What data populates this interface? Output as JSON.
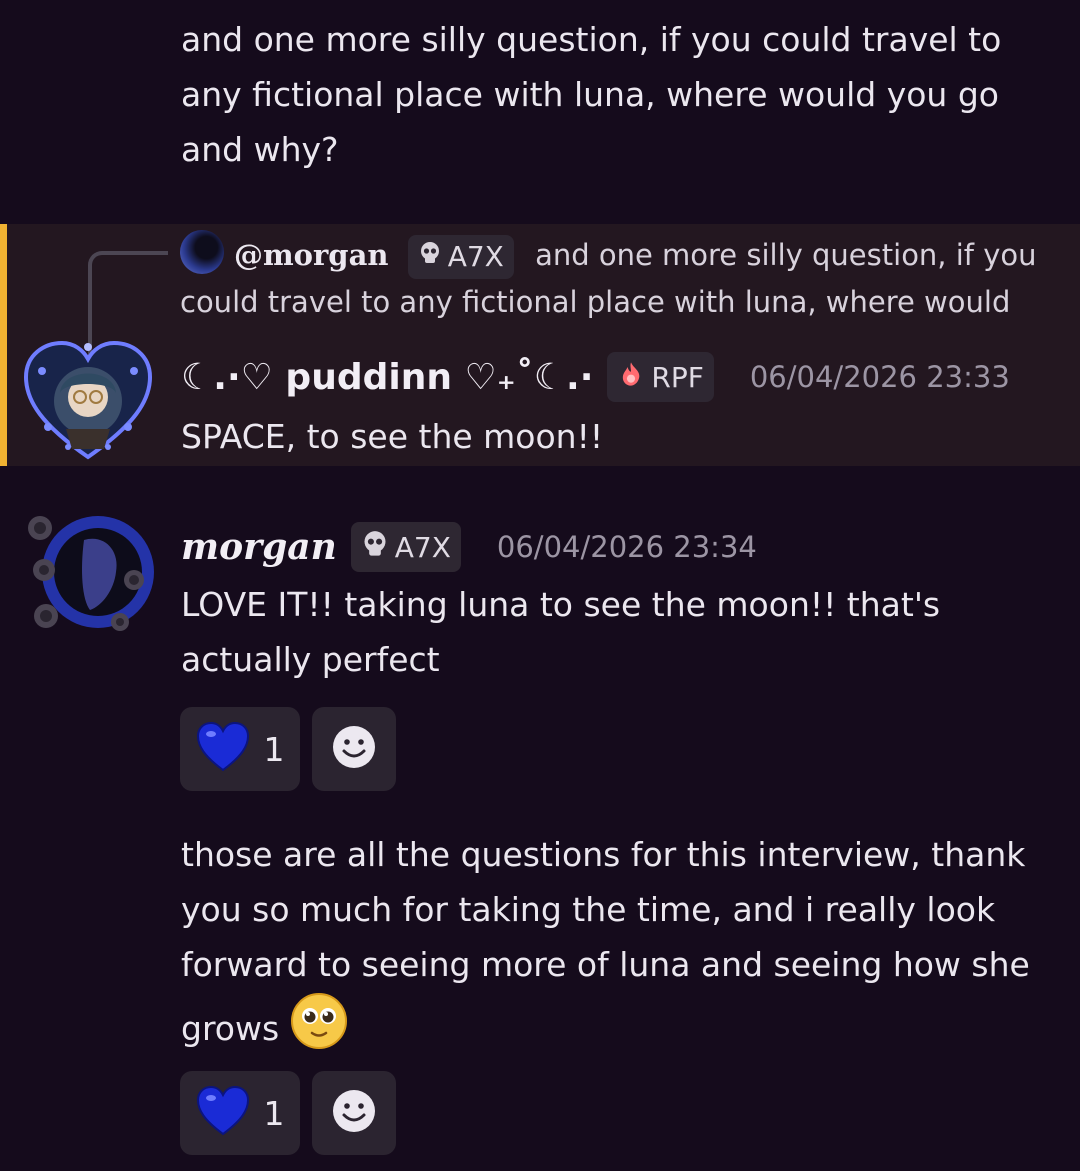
{
  "messages": {
    "top": {
      "text": "and one more silly question, if you could travel to any fictional place with luna, where would you go and why?"
    },
    "reply": {
      "ref_author": "@morgan",
      "ref_tag": "A7X",
      "ref_text": "and one more silly question, if you could travel to any fictional place with luna, where would",
      "author": "☾.·♡ puddinn ♡₊˚☾.·",
      "tag": "RPF",
      "timestamp": "06/04/2026 23:33",
      "text": "SPACE, to see the moon!!"
    },
    "morgan": {
      "author": "morgan",
      "tag": "A7X",
      "timestamp": "06/04/2026 23:34",
      "text": "LOVE IT!! taking luna to see the moon!! that's actually perfect",
      "reaction_count": "1"
    },
    "final": {
      "text": "those are all the questions for this interview, thank you so much for taking the time, and i really look forward to seeing more of luna and seeing how she grows",
      "reaction_count": "1"
    }
  },
  "colors": {
    "background": "#150b1c",
    "reply_highlight": "#231720",
    "reply_bar": "#f0b232",
    "heart": "#1a2bd6",
    "chip": "#2b2430"
  },
  "icons": [
    "skull-icon",
    "flame-icon",
    "blue-heart-icon",
    "add-reaction-icon",
    "pleading-face-emoji"
  ]
}
